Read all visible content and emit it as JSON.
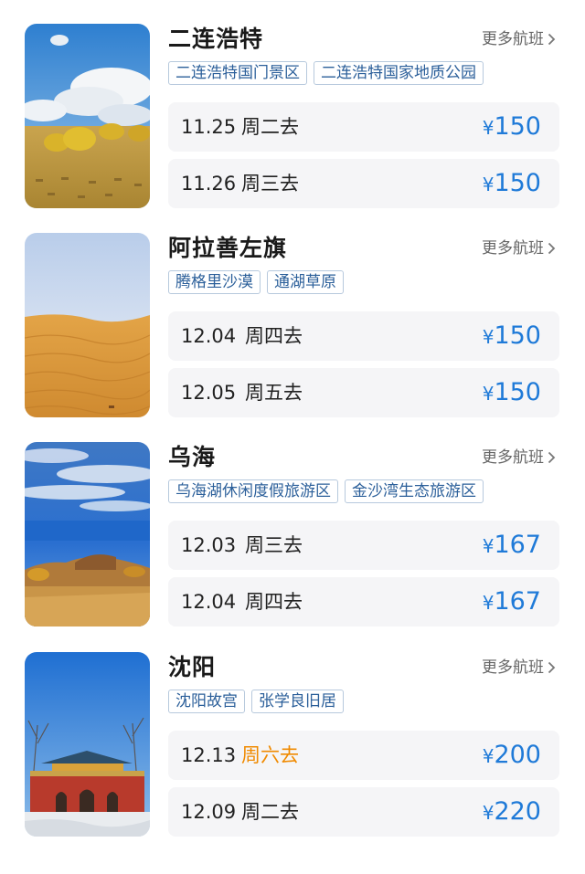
{
  "destinations": [
    {
      "city": "二连浩特",
      "more_label": "更多航班",
      "tags": [
        "二连浩特国门景区",
        "二连浩特国家地质公园"
      ],
      "flights": [
        {
          "date": "11.25",
          "day": "周二去",
          "currency": "¥",
          "price": "150",
          "weekend": false
        },
        {
          "date": "11.26",
          "day": "周三去",
          "currency": "¥",
          "price": "150",
          "weekend": false
        }
      ]
    },
    {
      "city": "阿拉善左旗",
      "more_label": "更多航班",
      "tags": [
        "腾格里沙漠",
        "通湖草原"
      ],
      "flights": [
        {
          "date": "12.04",
          "day": "周四去",
          "currency": "¥",
          "price": "150",
          "weekend": false
        },
        {
          "date": "12.05",
          "day": "周五去",
          "currency": "¥",
          "price": "150",
          "weekend": false
        }
      ]
    },
    {
      "city": "乌海",
      "more_label": "更多航班",
      "tags": [
        "乌海湖休闲度假旅游区",
        "金沙湾生态旅游区"
      ],
      "flights": [
        {
          "date": "12.03",
          "day": "周三去",
          "currency": "¥",
          "price": "167",
          "weekend": false
        },
        {
          "date": "12.04",
          "day": "周四去",
          "currency": "¥",
          "price": "167",
          "weekend": false
        }
      ]
    },
    {
      "city": "沈阳",
      "more_label": "更多航班",
      "tags": [
        "沈阳故宫",
        "张学良旧居"
      ],
      "flights": [
        {
          "date": "12.13",
          "day": "周六去",
          "currency": "¥",
          "price": "200",
          "weekend": true
        },
        {
          "date": "12.09",
          "day": "周二去",
          "currency": "¥",
          "price": "220",
          "weekend": false
        }
      ]
    }
  ],
  "colors": {
    "price": "#1f7ad8",
    "weekend_day": "#f08a00",
    "tag_text": "#2b5f9a",
    "row_bg": "#f5f5f7"
  },
  "icons": [
    "chevron-right-icon"
  ]
}
